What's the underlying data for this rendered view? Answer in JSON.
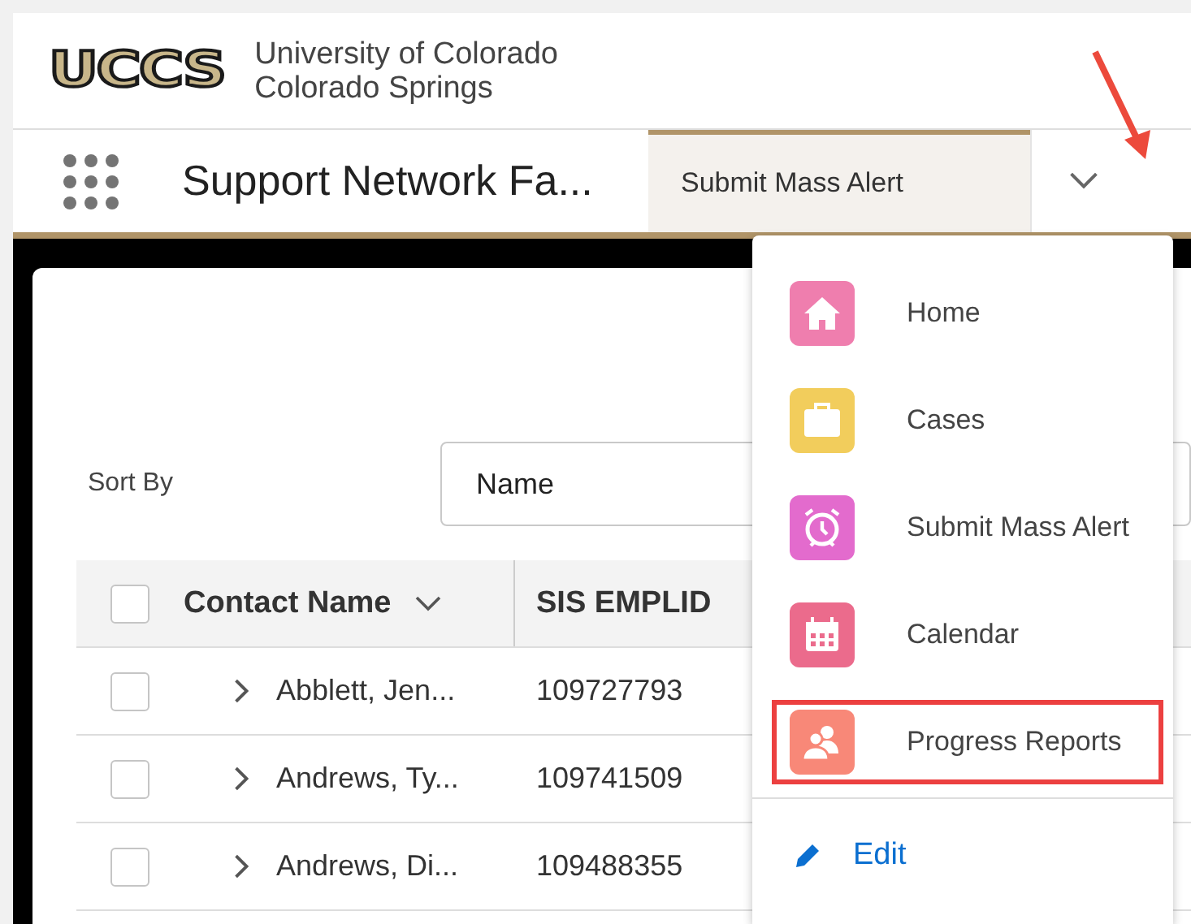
{
  "header": {
    "logo": "UCCS",
    "university_lines": [
      "University of Colorado",
      "Colorado Springs"
    ]
  },
  "nav": {
    "app_title": "Support Network Fa...",
    "tabs": [
      {
        "label": "Submit Mass Alert",
        "selected": true
      }
    ]
  },
  "sort": {
    "label": "Sort By",
    "value": "Name"
  },
  "table": {
    "select_all_checked": false,
    "columns": [
      "Contact Name",
      "SIS EMPLID"
    ],
    "rows": [
      {
        "checked": false,
        "name": "Abblett, Jen...",
        "emplid": "109727793"
      },
      {
        "checked": false,
        "name": "Andrews, Ty...",
        "emplid": "109741509"
      },
      {
        "checked": false,
        "name": "Andrews, Di...",
        "emplid": "109488355"
      }
    ]
  },
  "menu": {
    "items": [
      {
        "label": "Home",
        "kind": "home",
        "color": "#ef7eae",
        "highlighted": false
      },
      {
        "label": "Cases",
        "kind": "cases",
        "color": "#f2cd5c",
        "highlighted": false
      },
      {
        "label": "Submit Mass Alert",
        "kind": "alarm",
        "color": "#e36bcd",
        "highlighted": false
      },
      {
        "label": "Calendar",
        "kind": "calendar",
        "color": "#eb6b8c",
        "highlighted": false
      },
      {
        "label": "Progress Reports",
        "kind": "people",
        "color": "#f88878",
        "highlighted": true
      }
    ],
    "edit": "Edit"
  }
}
